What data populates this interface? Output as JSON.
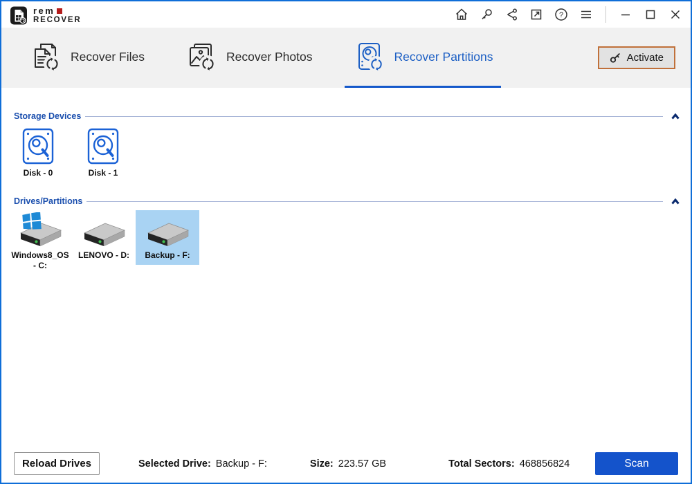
{
  "colors": {
    "window_border": "#0f6ed8",
    "tabbar_bg": "#f1f1f1",
    "accent_blue": "#1c5fc4",
    "tab_underline": "#1458ca",
    "section_title_blue": "#1b4fae",
    "section_line": "#a9b6d8",
    "chevron_navy": "#0a2a6e",
    "disk_icon_blue": "#1b62d6",
    "selection_bg": "#a9d3f3",
    "activate_border": "#c0703a",
    "activate_bg": "#e2e2e2",
    "scan_bg": "#1453cb",
    "logo_red": "#b41c1c"
  },
  "logo": {
    "line1": "rem",
    "line2": "RECOVER"
  },
  "titlebar": {
    "icons": [
      "home-icon",
      "license-key-icon",
      "share-icon",
      "open-external-icon",
      "help-icon",
      "menu-icon"
    ],
    "window_controls": [
      "minimize",
      "maximize",
      "close"
    ],
    "help_glyph": "?"
  },
  "tabs": [
    {
      "label": "Recover Files",
      "icon": "document-refresh-icon",
      "active": false
    },
    {
      "label": "Recover Photos",
      "icon": "photo-refresh-icon",
      "active": false
    },
    {
      "label": "Recover Partitions",
      "icon": "disk-refresh-icon",
      "active": true
    }
  ],
  "activate": {
    "label": "Activate",
    "icon": "key-icon"
  },
  "sections": [
    {
      "title": "Storage Devices",
      "items": [
        {
          "label": "Disk - 0",
          "icon": "disk-search-icon"
        },
        {
          "label": "Disk - 1",
          "icon": "disk-search-icon"
        }
      ]
    },
    {
      "title": "Drives/Partitions",
      "items": [
        {
          "label": "Windows8_OS - C:",
          "icon": "windows-drive-icon",
          "selected": false
        },
        {
          "label": "LENOVO - D:",
          "icon": "hard-drive-icon",
          "selected": false
        },
        {
          "label": "Backup - F:",
          "icon": "hard-drive-icon",
          "selected": true
        }
      ]
    }
  ],
  "footer": {
    "reload_label": "Reload Drives",
    "selected_drive_label": "Selected Drive:",
    "selected_drive_value": "Backup - F:",
    "size_label": "Size:",
    "size_value": "223.57 GB",
    "sectors_label": "Total Sectors:",
    "sectors_value": "468856824",
    "scan_label": "Scan"
  }
}
